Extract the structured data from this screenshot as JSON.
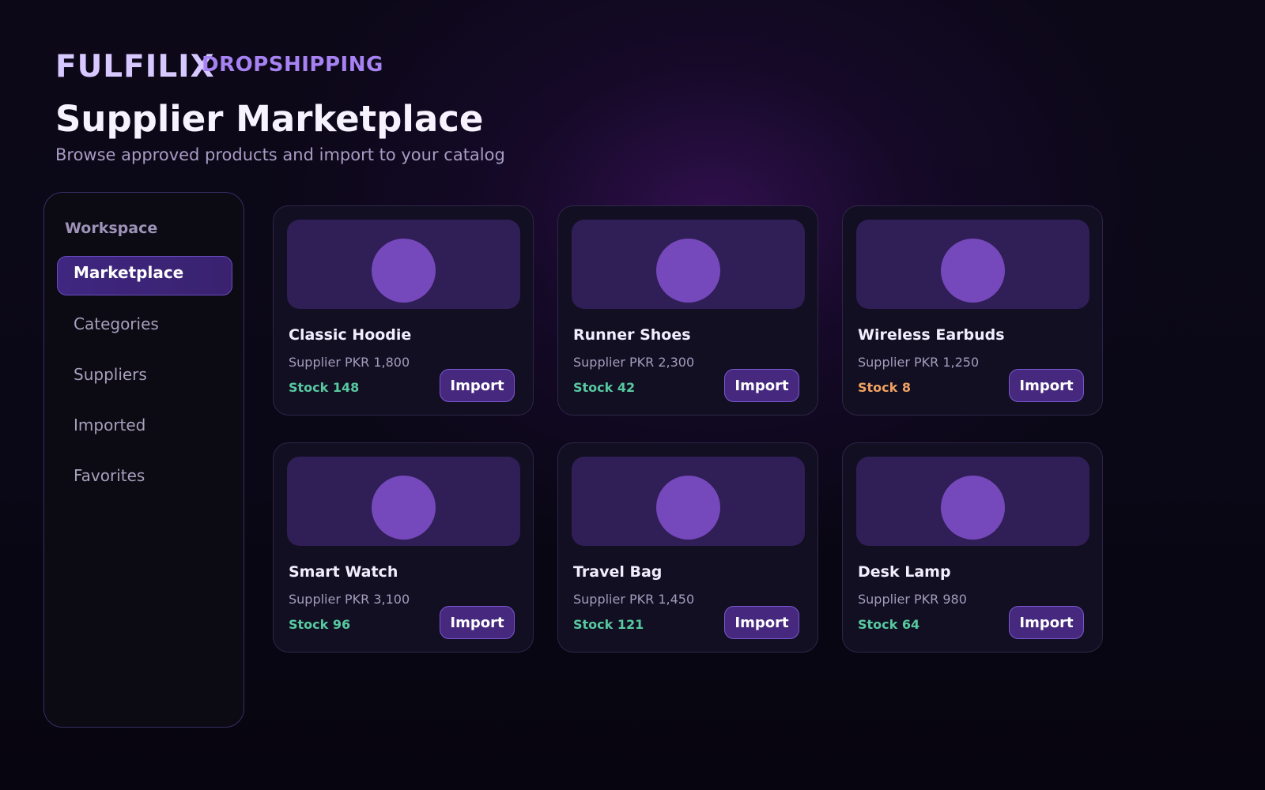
{
  "brand": {
    "name": "FULFILIX",
    "tagline": "DROPSHIPPING"
  },
  "header": {
    "title": "Supplier Marketplace",
    "subtitle": "Browse approved products and import to your catalog"
  },
  "sidebar": {
    "heading": "Workspace",
    "items": [
      {
        "label": "Marketplace",
        "active": true
      },
      {
        "label": "Categories",
        "active": false
      },
      {
        "label": "Suppliers",
        "active": false
      },
      {
        "label": "Imported",
        "active": false
      },
      {
        "label": "Favorites",
        "active": false
      }
    ]
  },
  "products": [
    {
      "name": "Classic Hoodie",
      "price": "Supplier PKR 1,800",
      "stock": "Stock 148",
      "stock_status": "ok",
      "action": "Import"
    },
    {
      "name": "Runner Shoes",
      "price": "Supplier PKR 2,300",
      "stock": "Stock 42",
      "stock_status": "ok",
      "action": "Import"
    },
    {
      "name": "Wireless Earbuds",
      "price": "Supplier PKR 1,250",
      "stock": "Stock 8",
      "stock_status": "low",
      "action": "Import"
    },
    {
      "name": "Smart Watch",
      "price": "Supplier PKR 3,100",
      "stock": "Stock 96",
      "stock_status": "ok",
      "action": "Import"
    },
    {
      "name": "Travel Bag",
      "price": "Supplier PKR 1,450",
      "stock": "Stock 121",
      "stock_status": "ok",
      "action": "Import"
    },
    {
      "name": "Desk Lamp",
      "price": "Supplier PKR 980",
      "stock": "Stock 64",
      "stock_status": "ok",
      "action": "Import"
    }
  ],
  "colors": {
    "accent": "#7549bb",
    "stock_ok": "#57c9a0",
    "stock_low": "#f0a261",
    "brand": "#d7c8ff"
  }
}
